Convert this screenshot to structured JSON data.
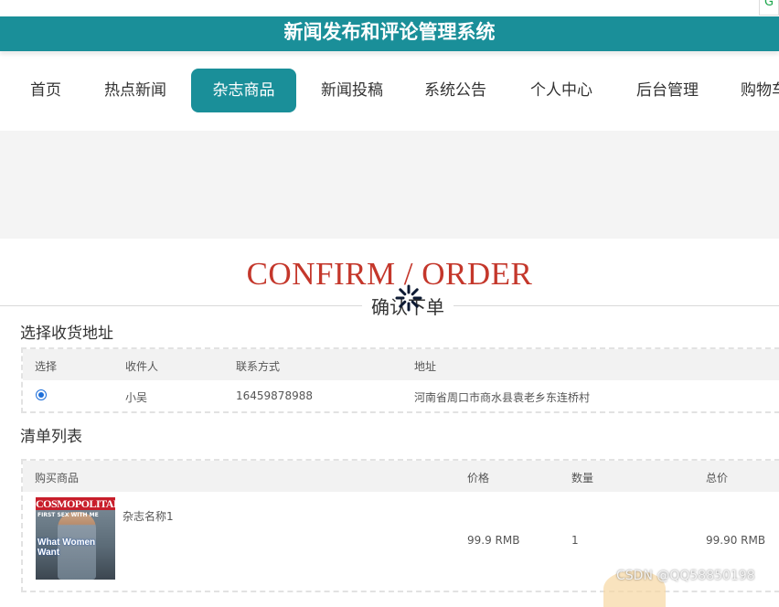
{
  "site": {
    "title": "新闻发布和评论管理系统"
  },
  "nav": [
    {
      "label": "首页"
    },
    {
      "label": "热点新闻"
    },
    {
      "label": "杂志商品",
      "active": true
    },
    {
      "label": "新闻投稿"
    },
    {
      "label": "系统公告"
    },
    {
      "label": "个人中心"
    },
    {
      "label": "后台管理"
    },
    {
      "label": "购物车"
    }
  ],
  "page": {
    "title_en": "CONFIRM / ORDER",
    "title_cn": "确认下单"
  },
  "address_section": {
    "title": "选择收货地址",
    "headers": {
      "select": "选择",
      "recipient": "收件人",
      "contact": "联系方式",
      "address": "地址"
    },
    "rows": [
      {
        "selected": true,
        "recipient": "小吴",
        "contact": "16459878988",
        "address": "河南省周口市商水县袁老乡东连桥村"
      }
    ]
  },
  "items_section": {
    "title": "清单列表",
    "headers": {
      "product": "购买商品",
      "price": "价格",
      "qty": "数量",
      "total": "总价"
    },
    "rows": [
      {
        "name": "杂志名称1",
        "price": "99.9 RMB",
        "qty": "1",
        "total": "99.90 RMB",
        "cover_masthead": "COSMOPOLITAN",
        "cover_text": "What Women Want",
        "cover_small": "FIRST SEX WITH ME"
      }
    ]
  },
  "watermark": "CSDN @QQ58850198",
  "colors": {
    "header": "#1a8f99",
    "accent_title": "#c4372b",
    "radio": "#1e6fd9"
  },
  "icons": {
    "browser_extension": "grammar-check-icon",
    "loading": "loading-spinner-icon"
  }
}
